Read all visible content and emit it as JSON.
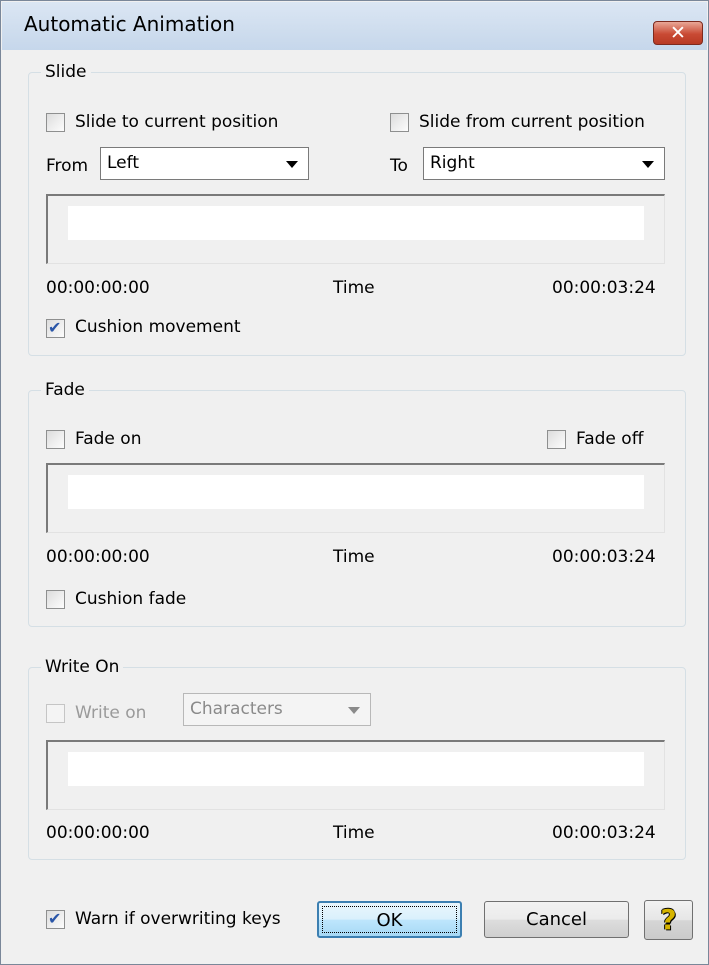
{
  "window": {
    "title": "Automatic Animation",
    "close_glyph": "✕"
  },
  "slide": {
    "group_label": "Slide",
    "slide_to_current": {
      "label": "Slide to current position",
      "checked": false
    },
    "slide_from_current": {
      "label": "Slide from current position",
      "checked": false
    },
    "from_label": "From",
    "from_value": "Left",
    "to_label": "To",
    "to_value": "Right",
    "time_start": "00:00:00:00",
    "time_label": "Time",
    "time_end": "00:00:03:24",
    "cushion": {
      "label": "Cushion movement",
      "checked": true
    }
  },
  "fade": {
    "group_label": "Fade",
    "fade_on": {
      "label": "Fade on",
      "checked": false
    },
    "fade_off": {
      "label": "Fade off",
      "checked": false
    },
    "time_start": "00:00:00:00",
    "time_label": "Time",
    "time_end": "00:00:03:24",
    "cushion": {
      "label": "Cushion fade",
      "checked": false
    }
  },
  "write_on": {
    "group_label": "Write On",
    "write_on": {
      "label": "Write on",
      "checked": false,
      "disabled": true
    },
    "mode_value": "Characters",
    "time_start": "00:00:00:00",
    "time_label": "Time",
    "time_end": "00:00:03:24"
  },
  "footer": {
    "warn": {
      "label": "Warn if overwriting keys",
      "checked": true
    },
    "ok_label": "OK",
    "cancel_label": "Cancel",
    "help_glyph": "?"
  },
  "colors": {
    "accent": "#2a56a8",
    "close_button": "#c94a34",
    "default_button_border": "#3c7fb1"
  },
  "icons": {
    "close": "close-icon",
    "help": "help-icon",
    "dropdown": "chevron-down-icon"
  }
}
